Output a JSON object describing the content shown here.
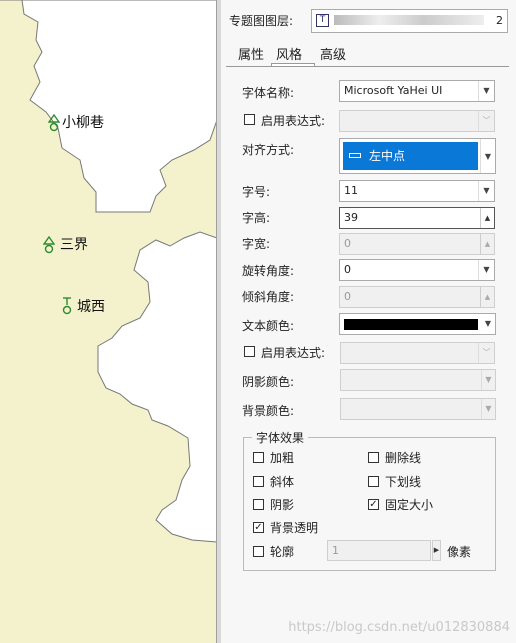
{
  "map": {
    "places": [
      {
        "name": "小柳巷",
        "symbol": "triangle-circle"
      },
      {
        "name": "三界",
        "symbol": "triangle-circle"
      },
      {
        "name": "城西",
        "symbol": "bar-circle"
      }
    ]
  },
  "panel": {
    "layer_label": "专题图图层:",
    "layer_value": "2",
    "tabs": [
      "属性",
      "风格",
      "高级"
    ],
    "active_tab": "风格",
    "font_name_label": "字体名称:",
    "font_name_value": "Microsoft YaHei UI",
    "enable_expr_label_1": "启用表达式:",
    "align_label": "对齐方式:",
    "align_value": "左中点",
    "font_size_label": "字号:",
    "font_size_value": "11",
    "font_height_label": "字高:",
    "font_height_value": "39",
    "font_width_label": "字宽:",
    "font_width_value": "0",
    "rotation_label": "旋转角度:",
    "rotation_value": "0",
    "slant_label": "倾斜角度:",
    "slant_value": "0",
    "text_color_label": "文本颜色:",
    "text_color": "#000000",
    "enable_expr_label_2": "启用表达式:",
    "shadow_color_label": "阴影颜色:",
    "bg_color_label": "背景颜色:",
    "effects_title": "字体效果",
    "effects": {
      "bold": {
        "label": "加粗",
        "checked": false
      },
      "strike": {
        "label": "删除线",
        "checked": false
      },
      "italic": {
        "label": "斜体",
        "checked": false
      },
      "underline": {
        "label": "下划线",
        "checked": false
      },
      "shadow": {
        "label": "阴影",
        "checked": false
      },
      "fixed_size": {
        "label": "固定大小",
        "checked": true
      },
      "bg_transparent": {
        "label": "背景透明",
        "checked": true
      },
      "outline": {
        "label": "轮廓",
        "checked": false
      }
    },
    "outline_value": "1",
    "outline_unit": "像素"
  },
  "watermark": "https://blog.csdn.net/u012830884",
  "colors": {
    "map_land": "#f4f2cc",
    "accent": "#0a78d7",
    "symbol": "#2e8b2e"
  }
}
